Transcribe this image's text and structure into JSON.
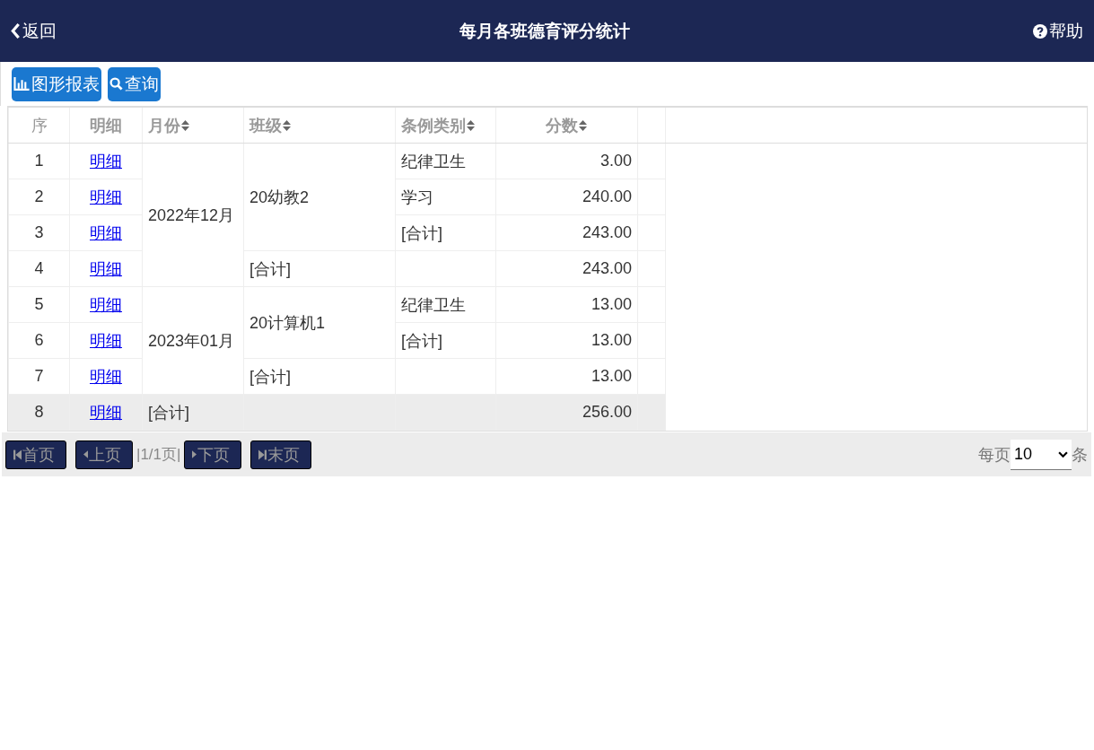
{
  "header": {
    "back": "返回",
    "title": "每月各班德育评分统计",
    "help": "帮助"
  },
  "toolbar": {
    "chart_button": "图形报表",
    "query_button": "查询"
  },
  "table": {
    "columns": [
      {
        "label": "序",
        "sortable": false
      },
      {
        "label": "明细",
        "sortable": false
      },
      {
        "label": "月份",
        "sortable": true
      },
      {
        "label": "班级",
        "sortable": true
      },
      {
        "label": "条例类别",
        "sortable": true
      },
      {
        "label": "分数",
        "sortable": true
      }
    ],
    "groups": [
      {
        "month": "2022年12月",
        "classes": [
          {
            "name": "20幼教2",
            "lines": [
              {
                "seq": "1",
                "detail": "明细",
                "category": "纪律卫生",
                "score": "3.00"
              },
              {
                "seq": "2",
                "detail": "明细",
                "category": "学习",
                "score": "240.00"
              },
              {
                "seq": "3",
                "detail": "明细",
                "category": "[合计]",
                "score": "243.00"
              }
            ]
          },
          {
            "name": "[合计]",
            "lines": [
              {
                "seq": "4",
                "detail": "明细",
                "score": "243.00"
              }
            ]
          }
        ]
      },
      {
        "month": "2023年01月",
        "classes": [
          {
            "name": "20计算机1",
            "lines": [
              {
                "seq": "5",
                "detail": "明细",
                "category": "纪律卫生",
                "score": "13.00"
              },
              {
                "seq": "6",
                "detail": "明细",
                "category": "[合计]",
                "score": "13.00"
              }
            ]
          },
          {
            "name": "[合计]",
            "lines": [
              {
                "seq": "7",
                "detail": "明细",
                "score": "13.00"
              }
            ]
          }
        ]
      }
    ],
    "total": {
      "seq": "8",
      "detail": "明细",
      "label": "[合计]",
      "score": "256.00"
    }
  },
  "pager": {
    "first": "首页",
    "prev": "上页",
    "info": "|1/1页|",
    "next": "下页",
    "last": "末页",
    "per_page_label": "每页",
    "per_page": "10",
    "unit": "条"
  }
}
